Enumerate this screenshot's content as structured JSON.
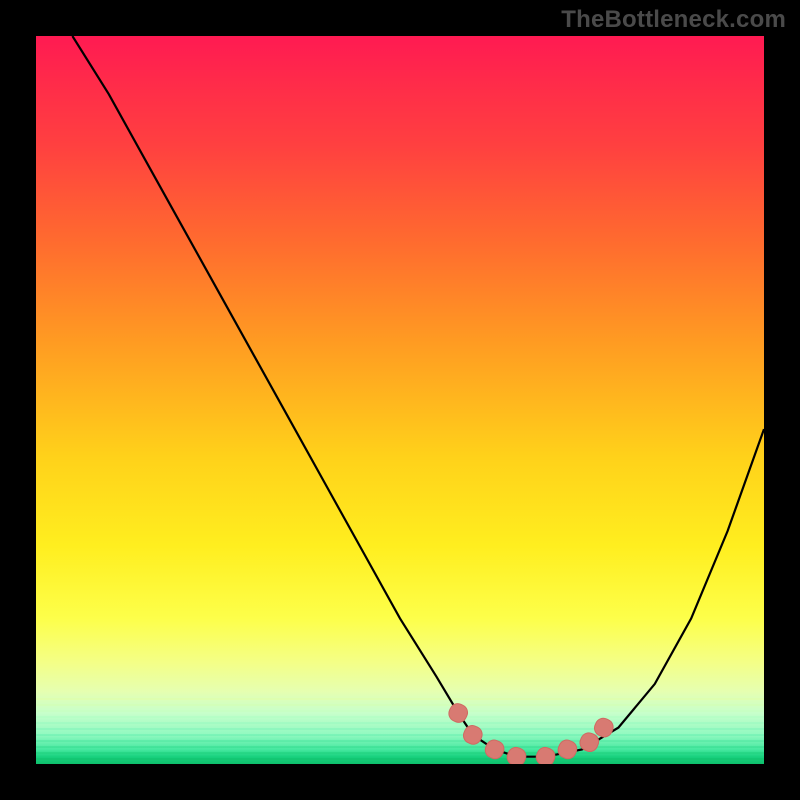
{
  "watermark": "TheBottleneck.com",
  "colors": {
    "curve_stroke": "#000000",
    "marker_fill": "#d87a72",
    "marker_stroke": "#cf6a62",
    "frame_bg": "#000000"
  },
  "chart_data": {
    "type": "line",
    "title": "",
    "xlabel": "",
    "ylabel": "",
    "xlim": [
      0,
      100
    ],
    "ylim": [
      0,
      100
    ],
    "grid": false,
    "series": [
      {
        "name": "bottleneck-curve",
        "x": [
          5,
          10,
          15,
          20,
          25,
          30,
          35,
          40,
          45,
          50,
          55,
          58,
          60,
          63,
          66,
          70,
          75,
          80,
          85,
          90,
          95,
          100
        ],
        "values": [
          100,
          92,
          83,
          74,
          65,
          56,
          47,
          38,
          29,
          20,
          12,
          7,
          4,
          2,
          1,
          1,
          2,
          5,
          11,
          20,
          32,
          46
        ]
      }
    ],
    "markers": [
      {
        "x": 58,
        "y": 7
      },
      {
        "x": 60,
        "y": 4
      },
      {
        "x": 63,
        "y": 2
      },
      {
        "x": 66,
        "y": 1
      },
      {
        "x": 70,
        "y": 1
      },
      {
        "x": 73,
        "y": 2
      },
      {
        "x": 76,
        "y": 3
      },
      {
        "x": 78,
        "y": 5
      }
    ]
  }
}
